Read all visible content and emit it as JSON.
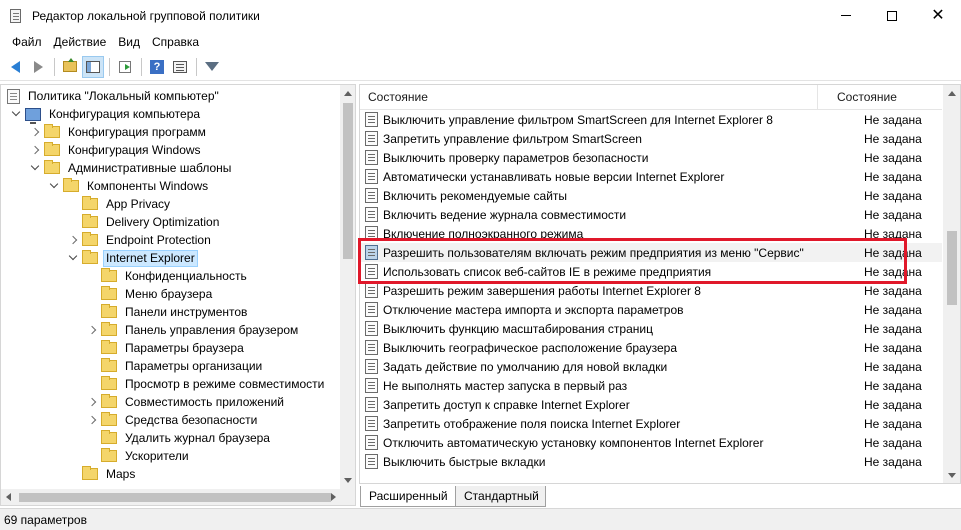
{
  "window": {
    "title": "Редактор локальной групповой политики",
    "close_symbol": "✕"
  },
  "menu": [
    "Файл",
    "Действие",
    "Вид",
    "Справка"
  ],
  "toolbar": {
    "help_symbol": "?"
  },
  "tree": {
    "items": [
      {
        "label": "Политика \"Локальный компьютер\"",
        "icon": "doc-icon",
        "twisty": "none",
        "indent": 0
      },
      {
        "label": "Конфигурация компьютера",
        "icon": "computer-icon",
        "twisty": "expanded",
        "indent": 1
      },
      {
        "label": "Конфигурация программ",
        "icon": "folder-icon",
        "twisty": "collapsed",
        "indent": 2
      },
      {
        "label": "Конфигурация Windows",
        "icon": "folder-icon",
        "twisty": "collapsed",
        "indent": 2
      },
      {
        "label": "Административные шаблоны",
        "icon": "folder-icon",
        "twisty": "expanded",
        "indent": 2
      },
      {
        "label": "Компоненты Windows",
        "icon": "folder-icon",
        "twisty": "expanded",
        "indent": 3
      },
      {
        "label": "App Privacy",
        "icon": "folder-icon",
        "twisty": "none",
        "indent": 4
      },
      {
        "label": "Delivery Optimization",
        "icon": "folder-icon",
        "twisty": "none",
        "indent": 4
      },
      {
        "label": "Endpoint Protection",
        "icon": "folder-icon",
        "twisty": "collapsed",
        "indent": 4
      },
      {
        "label": "Internet Explorer",
        "icon": "folder-icon",
        "twisty": "expanded",
        "indent": 4,
        "selected": true
      },
      {
        "label": "Конфиденциальность",
        "icon": "folder-icon",
        "twisty": "none",
        "indent": 5
      },
      {
        "label": "Меню браузера",
        "icon": "folder-icon",
        "twisty": "none",
        "indent": 5
      },
      {
        "label": "Панели инструментов",
        "icon": "folder-icon",
        "twisty": "none",
        "indent": 5
      },
      {
        "label": "Панель управления браузером",
        "icon": "folder-icon",
        "twisty": "collapsed",
        "indent": 5
      },
      {
        "label": "Параметры браузера",
        "icon": "folder-icon",
        "twisty": "none",
        "indent": 5
      },
      {
        "label": "Параметры организации",
        "icon": "folder-icon",
        "twisty": "none",
        "indent": 5
      },
      {
        "label": "Просмотр в режиме совместимости",
        "icon": "folder-icon",
        "twisty": "none",
        "indent": 5
      },
      {
        "label": "Совместимость приложений",
        "icon": "folder-icon",
        "twisty": "collapsed",
        "indent": 5
      },
      {
        "label": "Средства безопасности",
        "icon": "folder-icon",
        "twisty": "collapsed",
        "indent": 5
      },
      {
        "label": "Удалить журнал браузера",
        "icon": "folder-icon",
        "twisty": "none",
        "indent": 5
      },
      {
        "label": "Ускорители",
        "icon": "folder-icon",
        "twisty": "none",
        "indent": 5
      },
      {
        "label": "Maps",
        "icon": "folder-icon",
        "twisty": "none",
        "indent": 4
      }
    ]
  },
  "list": {
    "columns": {
      "name": "Состояние",
      "state": "Состояние"
    },
    "rows": [
      {
        "name": "Выключить управление фильтром SmartScreen для Internet Explorer 8",
        "state": "Не задана"
      },
      {
        "name": "Запретить управление фильтром SmartScreen",
        "state": "Не задана"
      },
      {
        "name": "Выключить проверку параметров безопасности",
        "state": "Не задана"
      },
      {
        "name": "Автоматически устанавливать новые версии Internet Explorer",
        "state": "Не задана"
      },
      {
        "name": "Включить рекомендуемые сайты",
        "state": "Не задана"
      },
      {
        "name": "Включить ведение журнала совместимости",
        "state": "Не задана"
      },
      {
        "name": "Включение полноэкранного режима",
        "state": "Не задана"
      },
      {
        "name": "Разрешить пользователям включать режим предприятия из меню \"Сервис\"",
        "state": "Не задана",
        "hover": true,
        "alt_icon": true
      },
      {
        "name": "Использовать список веб-сайтов IE в режиме предприятия",
        "state": "Не задана"
      },
      {
        "name": "Разрешить режим завершения работы Internet Explorer 8",
        "state": "Не задана"
      },
      {
        "name": "Отключение мастера импорта и экспорта параметров",
        "state": "Не задана"
      },
      {
        "name": "Выключить функцию масштабирования страниц",
        "state": "Не задана"
      },
      {
        "name": "Выключить географическое расположение браузера",
        "state": "Не задана"
      },
      {
        "name": "Задать действие по умолчанию для новой вкладки",
        "state": "Не задана"
      },
      {
        "name": "Не выполнять мастер запуска в первый раз",
        "state": "Не задана"
      },
      {
        "name": "Запретить доступ к справке Internet Explorer",
        "state": "Не задана"
      },
      {
        "name": "Запретить отображение поля поиска Internet Explorer",
        "state": "Не задана"
      },
      {
        "name": "Отключить автоматическую установку компонентов Internet Explorer",
        "state": "Не задана"
      },
      {
        "name": "Выключить быстрые вкладки",
        "state": "Не задана"
      }
    ]
  },
  "tabs": {
    "extended": "Расширенный",
    "standard": "Стандартный"
  },
  "status": {
    "text": "69 параметров"
  },
  "colors": {
    "highlight": "#e0182a",
    "selection": "#cce8ff"
  }
}
